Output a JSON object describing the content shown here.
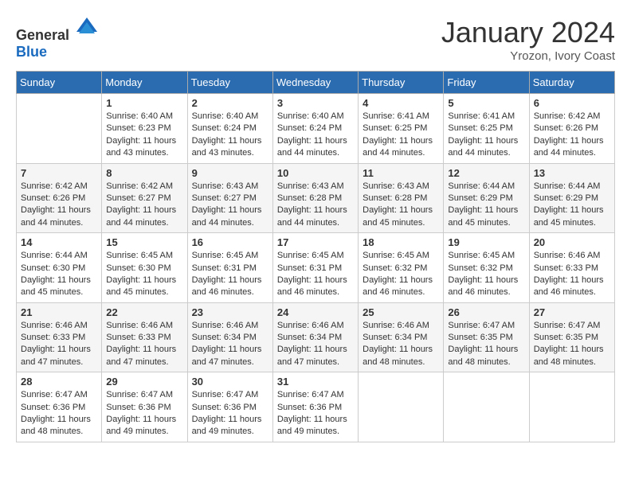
{
  "header": {
    "logo": {
      "general": "General",
      "blue": "Blue"
    },
    "title": "January 2024",
    "location": "Yrozon, Ivory Coast"
  },
  "weekdays": [
    "Sunday",
    "Monday",
    "Tuesday",
    "Wednesday",
    "Thursday",
    "Friday",
    "Saturday"
  ],
  "weeks": [
    [
      {
        "day": null,
        "sunrise": null,
        "sunset": null,
        "daylight": null
      },
      {
        "day": "1",
        "sunrise": "Sunrise: 6:40 AM",
        "sunset": "Sunset: 6:23 PM",
        "daylight": "Daylight: 11 hours and 43 minutes."
      },
      {
        "day": "2",
        "sunrise": "Sunrise: 6:40 AM",
        "sunset": "Sunset: 6:24 PM",
        "daylight": "Daylight: 11 hours and 43 minutes."
      },
      {
        "day": "3",
        "sunrise": "Sunrise: 6:40 AM",
        "sunset": "Sunset: 6:24 PM",
        "daylight": "Daylight: 11 hours and 44 minutes."
      },
      {
        "day": "4",
        "sunrise": "Sunrise: 6:41 AM",
        "sunset": "Sunset: 6:25 PM",
        "daylight": "Daylight: 11 hours and 44 minutes."
      },
      {
        "day": "5",
        "sunrise": "Sunrise: 6:41 AM",
        "sunset": "Sunset: 6:25 PM",
        "daylight": "Daylight: 11 hours and 44 minutes."
      },
      {
        "day": "6",
        "sunrise": "Sunrise: 6:42 AM",
        "sunset": "Sunset: 6:26 PM",
        "daylight": "Daylight: 11 hours and 44 minutes."
      }
    ],
    [
      {
        "day": "7",
        "sunrise": "Sunrise: 6:42 AM",
        "sunset": "Sunset: 6:26 PM",
        "daylight": "Daylight: 11 hours and 44 minutes."
      },
      {
        "day": "8",
        "sunrise": "Sunrise: 6:42 AM",
        "sunset": "Sunset: 6:27 PM",
        "daylight": "Daylight: 11 hours and 44 minutes."
      },
      {
        "day": "9",
        "sunrise": "Sunrise: 6:43 AM",
        "sunset": "Sunset: 6:27 PM",
        "daylight": "Daylight: 11 hours and 44 minutes."
      },
      {
        "day": "10",
        "sunrise": "Sunrise: 6:43 AM",
        "sunset": "Sunset: 6:28 PM",
        "daylight": "Daylight: 11 hours and 44 minutes."
      },
      {
        "day": "11",
        "sunrise": "Sunrise: 6:43 AM",
        "sunset": "Sunset: 6:28 PM",
        "daylight": "Daylight: 11 hours and 45 minutes."
      },
      {
        "day": "12",
        "sunrise": "Sunrise: 6:44 AM",
        "sunset": "Sunset: 6:29 PM",
        "daylight": "Daylight: 11 hours and 45 minutes."
      },
      {
        "day": "13",
        "sunrise": "Sunrise: 6:44 AM",
        "sunset": "Sunset: 6:29 PM",
        "daylight": "Daylight: 11 hours and 45 minutes."
      }
    ],
    [
      {
        "day": "14",
        "sunrise": "Sunrise: 6:44 AM",
        "sunset": "Sunset: 6:30 PM",
        "daylight": "Daylight: 11 hours and 45 minutes."
      },
      {
        "day": "15",
        "sunrise": "Sunrise: 6:45 AM",
        "sunset": "Sunset: 6:30 PM",
        "daylight": "Daylight: 11 hours and 45 minutes."
      },
      {
        "day": "16",
        "sunrise": "Sunrise: 6:45 AM",
        "sunset": "Sunset: 6:31 PM",
        "daylight": "Daylight: 11 hours and 46 minutes."
      },
      {
        "day": "17",
        "sunrise": "Sunrise: 6:45 AM",
        "sunset": "Sunset: 6:31 PM",
        "daylight": "Daylight: 11 hours and 46 minutes."
      },
      {
        "day": "18",
        "sunrise": "Sunrise: 6:45 AM",
        "sunset": "Sunset: 6:32 PM",
        "daylight": "Daylight: 11 hours and 46 minutes."
      },
      {
        "day": "19",
        "sunrise": "Sunrise: 6:45 AM",
        "sunset": "Sunset: 6:32 PM",
        "daylight": "Daylight: 11 hours and 46 minutes."
      },
      {
        "day": "20",
        "sunrise": "Sunrise: 6:46 AM",
        "sunset": "Sunset: 6:33 PM",
        "daylight": "Daylight: 11 hours and 46 minutes."
      }
    ],
    [
      {
        "day": "21",
        "sunrise": "Sunrise: 6:46 AM",
        "sunset": "Sunset: 6:33 PM",
        "daylight": "Daylight: 11 hours and 47 minutes."
      },
      {
        "day": "22",
        "sunrise": "Sunrise: 6:46 AM",
        "sunset": "Sunset: 6:33 PM",
        "daylight": "Daylight: 11 hours and 47 minutes."
      },
      {
        "day": "23",
        "sunrise": "Sunrise: 6:46 AM",
        "sunset": "Sunset: 6:34 PM",
        "daylight": "Daylight: 11 hours and 47 minutes."
      },
      {
        "day": "24",
        "sunrise": "Sunrise: 6:46 AM",
        "sunset": "Sunset: 6:34 PM",
        "daylight": "Daylight: 11 hours and 47 minutes."
      },
      {
        "day": "25",
        "sunrise": "Sunrise: 6:46 AM",
        "sunset": "Sunset: 6:34 PM",
        "daylight": "Daylight: 11 hours and 48 minutes."
      },
      {
        "day": "26",
        "sunrise": "Sunrise: 6:47 AM",
        "sunset": "Sunset: 6:35 PM",
        "daylight": "Daylight: 11 hours and 48 minutes."
      },
      {
        "day": "27",
        "sunrise": "Sunrise: 6:47 AM",
        "sunset": "Sunset: 6:35 PM",
        "daylight": "Daylight: 11 hours and 48 minutes."
      }
    ],
    [
      {
        "day": "28",
        "sunrise": "Sunrise: 6:47 AM",
        "sunset": "Sunset: 6:36 PM",
        "daylight": "Daylight: 11 hours and 48 minutes."
      },
      {
        "day": "29",
        "sunrise": "Sunrise: 6:47 AM",
        "sunset": "Sunset: 6:36 PM",
        "daylight": "Daylight: 11 hours and 49 minutes."
      },
      {
        "day": "30",
        "sunrise": "Sunrise: 6:47 AM",
        "sunset": "Sunset: 6:36 PM",
        "daylight": "Daylight: 11 hours and 49 minutes."
      },
      {
        "day": "31",
        "sunrise": "Sunrise: 6:47 AM",
        "sunset": "Sunset: 6:36 PM",
        "daylight": "Daylight: 11 hours and 49 minutes."
      },
      {
        "day": null,
        "sunrise": null,
        "sunset": null,
        "daylight": null
      },
      {
        "day": null,
        "sunrise": null,
        "sunset": null,
        "daylight": null
      },
      {
        "day": null,
        "sunrise": null,
        "sunset": null,
        "daylight": null
      }
    ]
  ]
}
